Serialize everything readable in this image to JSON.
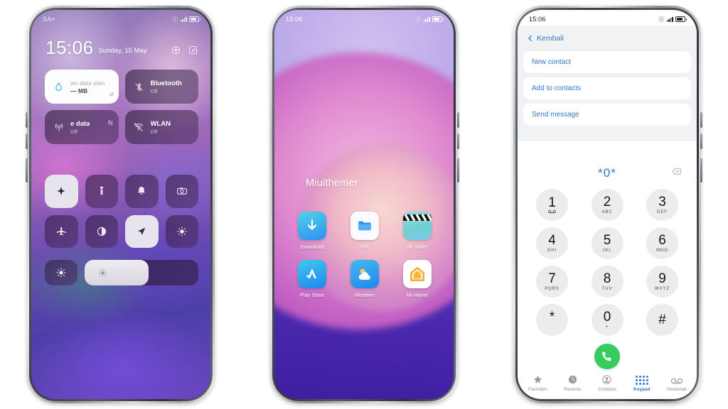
{
  "scene": {
    "background": "#ffffff",
    "phone_count": 3
  },
  "phone1": {
    "name": "control-center",
    "status": {
      "carrier": "SA+",
      "signal": "signal-bars-icon",
      "battery": "battery-icon",
      "mute": "mute-icon"
    },
    "clock": {
      "time": "15:06",
      "date": "Sunday, 15 May"
    },
    "actions": [
      {
        "name": "settings-gear-icon",
        "label": "Settings"
      },
      {
        "name": "edit-icon",
        "label": "Edit"
      }
    ],
    "tiles": [
      {
        "name": "data-plan-card",
        "title": "wn data plan",
        "sub": "— MB",
        "icon": "water-drop-icon",
        "style": "light",
        "corner": "signal-corner-icon"
      },
      {
        "name": "bluetooth-tile",
        "title": "Bluetooth",
        "sub": "Off",
        "icon": "bluetooth-off-icon",
        "style": "dark"
      },
      {
        "name": "mobile-data-tile",
        "title": "e data",
        "sub": "Off",
        "icon": "cell-tower-icon",
        "style": "dark",
        "trail": "N"
      },
      {
        "name": "wlan-tile",
        "title": "WLAN",
        "sub": "Off",
        "icon": "wifi-off-icon",
        "style": "dark"
      }
    ],
    "toggles": [
      {
        "name": "auto-brightness-toggle",
        "icon": "sparkle-icon",
        "on": true
      },
      {
        "name": "flashlight-toggle",
        "icon": "flashlight-icon",
        "on": false
      },
      {
        "name": "ringer-toggle",
        "icon": "bell-icon",
        "on": false
      },
      {
        "name": "screenshot-toggle",
        "icon": "camera-icon",
        "on": false
      },
      {
        "name": "airplane-mode-toggle",
        "icon": "airplane-icon",
        "on": false
      },
      {
        "name": "dark-mode-toggle",
        "icon": "contrast-icon",
        "on": false
      },
      {
        "name": "location-toggle",
        "icon": "location-arrow-icon",
        "on": true
      },
      {
        "name": "reading-mode-toggle",
        "icon": "sun-moon-icon",
        "on": false
      }
    ],
    "brightness": {
      "name": "brightness-slider",
      "icon": "brightness-icon",
      "value_percent": 56
    }
  },
  "phone2": {
    "name": "home-screen",
    "status": {
      "time": "15:06",
      "signal": "signal-bars-icon",
      "battery": "battery-icon",
      "mute": "mute-icon"
    },
    "brand": "Miuithemer",
    "apps": [
      {
        "name": "app-download",
        "label": "Download",
        "icon": "download-arrow-icon"
      },
      {
        "name": "app-file",
        "label": "File",
        "icon": "folder-icon"
      },
      {
        "name": "app-mi-video",
        "label": "Mi Video",
        "icon": "clapperboard-icon"
      },
      {
        "name": "app-play-store",
        "label": "Play Store",
        "icon": "app-store-a-icon"
      },
      {
        "name": "app-weather",
        "label": "Weather",
        "icon": "sun-cloud-icon"
      },
      {
        "name": "app-mi-home",
        "label": "Mi Home",
        "icon": "house-icon"
      }
    ]
  },
  "phone3": {
    "name": "dialer-screen",
    "status": {
      "time": "15:06",
      "signal": "signal-bars-icon",
      "battery": "battery-icon",
      "mute": "mute-icon"
    },
    "back_label": "Kembali",
    "menu": [
      {
        "name": "new-contact-item",
        "label": "New contact"
      },
      {
        "name": "add-to-contacts-item",
        "label": "Add to contacts"
      },
      {
        "name": "send-message-item",
        "label": "Send message"
      }
    ],
    "input": {
      "value": "*0*",
      "backspace": "backspace-icon"
    },
    "keys": [
      {
        "digit": "1",
        "sub": "",
        "icon": "voicemail-icon"
      },
      {
        "digit": "2",
        "sub": "ABC"
      },
      {
        "digit": "3",
        "sub": "DEF"
      },
      {
        "digit": "4",
        "sub": "GHI"
      },
      {
        "digit": "5",
        "sub": "JKL"
      },
      {
        "digit": "6",
        "sub": "MNO"
      },
      {
        "digit": "7",
        "sub": "PQRS"
      },
      {
        "digit": "8",
        "sub": "TUV"
      },
      {
        "digit": "9",
        "sub": "WXYZ"
      },
      {
        "digit": "*",
        "sub": ","
      },
      {
        "digit": "0",
        "sub": "+"
      },
      {
        "digit": "#",
        "sub": ""
      }
    ],
    "call_button": {
      "name": "call-button",
      "icon": "phone-handset-icon",
      "color": "#36cc5d"
    },
    "tabs": [
      {
        "name": "tab-favorites",
        "label": "Favorites",
        "icon": "star-icon",
        "active": false
      },
      {
        "name": "tab-recents",
        "label": "Recents",
        "icon": "clock-icon",
        "active": false
      },
      {
        "name": "tab-contacts",
        "label": "Contacts",
        "icon": "person-circle-icon",
        "active": false
      },
      {
        "name": "tab-keypad",
        "label": "Keypad",
        "icon": "keypad-dots-icon",
        "active": true
      },
      {
        "name": "tab-voicemail",
        "label": "Voicemail",
        "icon": "voicemail-icon",
        "active": false
      }
    ],
    "accent_color": "#3478c6"
  }
}
